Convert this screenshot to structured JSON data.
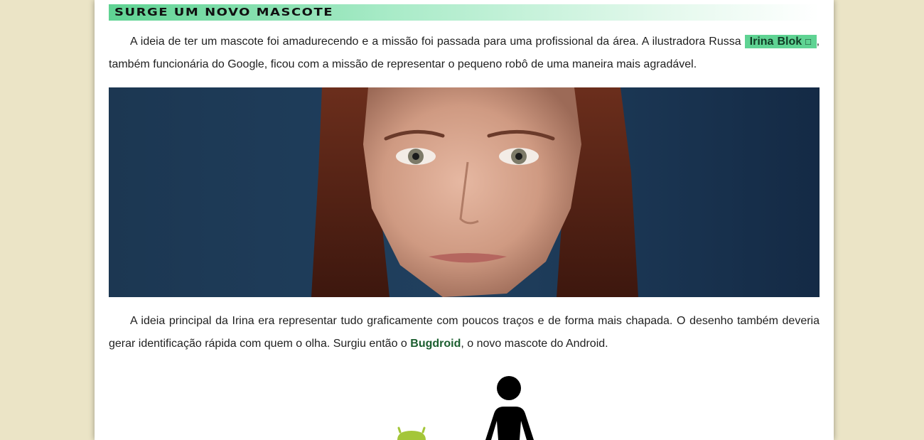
{
  "section": {
    "heading": "Surge um novo mascote"
  },
  "paragraph1": {
    "text_before": "A ideia de ter um mascote foi amadurecendo e a missão foi passada para uma profissional da área. A ilustradora Russa ",
    "link_label": "Irina Blok",
    "link_icon": "external-link-icon",
    "text_after": ", também funcionária do Google, ficou com a missão de representar o pequeno robô de uma maneira mais agradável."
  },
  "paragraph2": {
    "text_before": "A ideia principal da Irina era representar tudo graficamente com poucos traços e de forma mais chapada. O desenho também deveria gerar identificação rápida com quem o olha. Surgiu então o ",
    "highlight": "Bugdroid",
    "text_after": ", o novo mascote do Android."
  },
  "colors": {
    "page_background": "#ebe4c6",
    "heading_gradient_start": "#5fd393",
    "link_background": "#5fd393",
    "highlight_text": "#1b5e2f",
    "android_green": "#a4c639"
  }
}
